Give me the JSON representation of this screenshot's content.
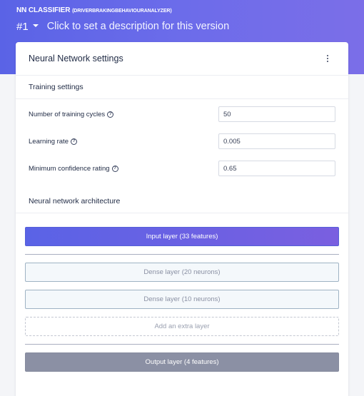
{
  "header": {
    "app_title": "NN CLASSIFIER",
    "app_subtitle": "(DRIVERBRAKINGBEHAVIOURANALYZER)",
    "version_label": "#1",
    "version_description": "Click to set a description for this version",
    "gradient_start": "#5a63e6",
    "gradient_end": "#7b6ee8"
  },
  "card": {
    "title": "Neural Network settings",
    "menu_icon": "kebab-menu-icon"
  },
  "training_settings": {
    "heading": "Training settings",
    "fields": [
      {
        "label": "Number of training cycles",
        "value": "50"
      },
      {
        "label": "Learning rate",
        "value": "0.005"
      },
      {
        "label": "Minimum confidence rating",
        "value": "0.65"
      }
    ],
    "help_glyph": "?"
  },
  "architecture": {
    "heading": "Neural network architecture",
    "input_layer": "Input layer (33 features)",
    "dense_layers": [
      "Dense layer (20 neurons)",
      "Dense layer (10 neurons)"
    ],
    "add_layer": "Add an extra layer",
    "output_layer": "Output layer (4 features)",
    "input_color": "#5a63e6",
    "output_color": "#8b90a4"
  }
}
